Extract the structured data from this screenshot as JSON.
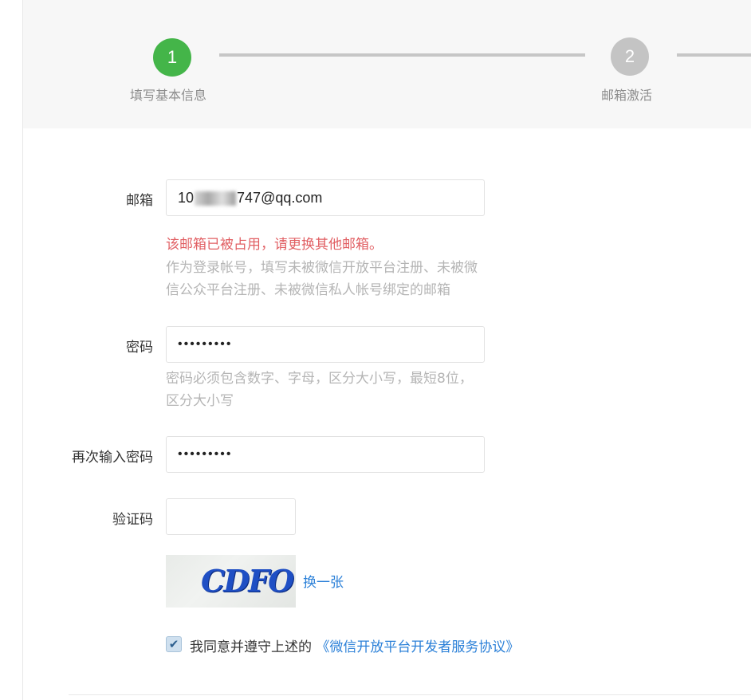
{
  "steps": [
    {
      "number": "1",
      "label": "填写基本信息",
      "state": "active"
    },
    {
      "number": "2",
      "label": "邮箱激活",
      "state": "pending"
    }
  ],
  "colors": {
    "active_step": "#44b549",
    "pending_step": "#c4c4c4",
    "error_text": "#e15f63",
    "link": "#2b80d8",
    "hint_text": "#b5b5b5"
  },
  "form": {
    "email": {
      "label": "邮箱",
      "value_prefix": "10",
      "value_suffix": "747@qq.com",
      "error": "该邮箱已被占用，请更换其他邮箱。",
      "hint": "作为登录帐号，填写未被微信开放平台注册、未被微信公众平台注册、未被微信私人帐号绑定的邮箱"
    },
    "password": {
      "label": "密码",
      "value": "•••••••••",
      "hint": "密码必须包含数字、字母，区分大小写，最短8位，区分大小写"
    },
    "confirm_password": {
      "label": "再次输入密码",
      "value": "•••••••••"
    },
    "captcha": {
      "label": "验证码",
      "value": "",
      "image_text": "CDFO",
      "refresh_label": "换一张"
    },
    "agreement": {
      "checked": true,
      "text": "我同意并遵守上述的",
      "link_text": "《微信开放平台开发者服务协议》",
      "check_icon": "checkmark-icon"
    }
  }
}
